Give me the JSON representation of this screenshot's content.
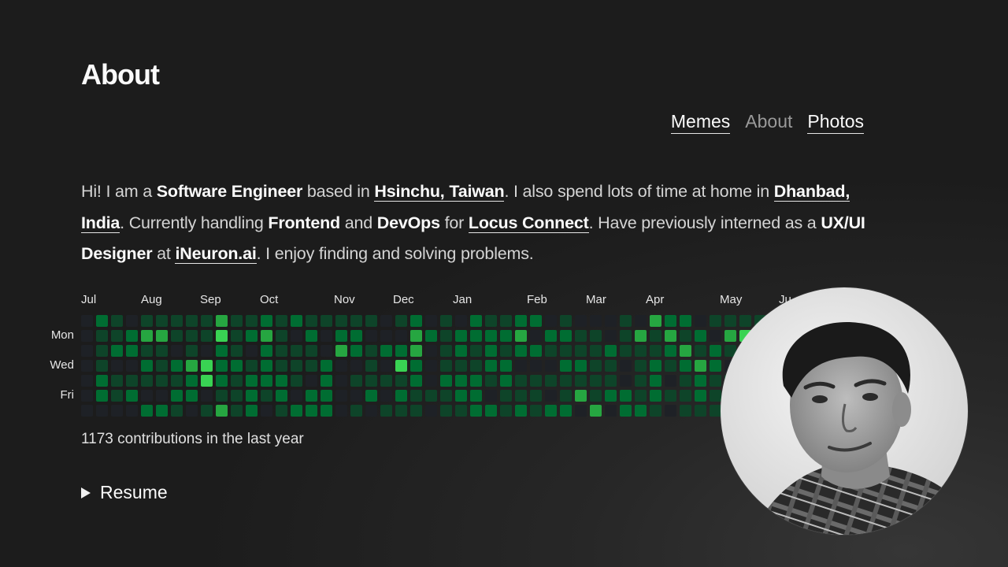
{
  "page": {
    "title": "About"
  },
  "nav": {
    "items": [
      {
        "label": "Memes",
        "current": false
      },
      {
        "label": "About",
        "current": true
      },
      {
        "label": "Photos",
        "current": false
      }
    ]
  },
  "intro": {
    "s1": "Hi! I am a ",
    "role": "Software Engineer",
    "s2": " based in ",
    "city": "Hsinchu, Taiwan",
    "s3": ". I also spend lots of time at home in ",
    "home": "Dhanbad, India",
    "s4": ". Currently handling ",
    "area1": "Frontend",
    "s5": " and ",
    "area2": "DevOps",
    "s6": " for ",
    "company": "Locus Connect",
    "s7": ". Have previously interned as a ",
    "intern_role": "UX/UI Designer",
    "s8": " at ",
    "intern_company": "iNeuron.ai",
    "s9": ". I enjoy finding and solving problems."
  },
  "contributions": {
    "months": [
      "Jul",
      "Aug",
      "Sep",
      "Oct",
      "Nov",
      "Dec",
      "Jan",
      "Feb",
      "Mar",
      "Apr",
      "May",
      "Ju"
    ],
    "day_labels": [
      "Mon",
      "Wed",
      "Fri"
    ],
    "total_text": "1173 contributions in the last year",
    "colors": {
      "empty": "#1e2126",
      "level1": "#0e4429",
      "level2": "#006d32",
      "level3": "#26a641",
      "level4": "#39d353"
    }
  },
  "resume": {
    "label": "Resume"
  },
  "avatar": {
    "alt": "profile-photo"
  }
}
